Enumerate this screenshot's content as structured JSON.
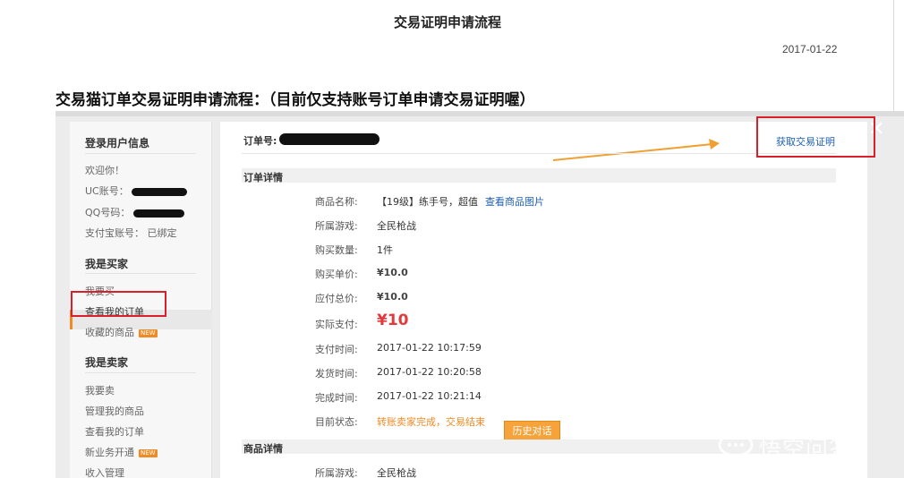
{
  "doc": {
    "title": "交易证明申请流程",
    "date": "2017-01-22",
    "heading": "交易猫订单交易证明申请流程：（目前仅支持账号订单申请交易证明喔）"
  },
  "sidebar": {
    "user_section": {
      "title": "登录用户信息",
      "welcome": "欢迎你！",
      "uc_label": "UC账号：",
      "qq_label": "QQ号码：",
      "alipay": "支付宝账号：  已绑定"
    },
    "buyer_section": {
      "title": "我是买家",
      "items": [
        "我要买",
        "查看我的订单",
        "收藏的商品"
      ]
    },
    "seller_section": {
      "title": "我是卖家",
      "items": [
        "我要卖",
        "管理我的商品",
        "查看我的订单",
        "新业务开通",
        "收入管理"
      ]
    },
    "new_badge": "NEW"
  },
  "order": {
    "number_label": "订单号:",
    "get_cert": "获取交易证明",
    "details_title": "订单详情",
    "goods_title": "商品详情",
    "history_button": "历史对话",
    "view_images": "查看商品图片",
    "fields": [
      {
        "label": "商品名称:",
        "value": "【19级】练手号，超值"
      },
      {
        "label": "所属游戏:",
        "value": "全民枪战"
      },
      {
        "label": "购买数量:",
        "value": "1件"
      },
      {
        "label": "购买单价:",
        "value": "¥10.0"
      },
      {
        "label": "应付总价:",
        "value": "¥10.0"
      },
      {
        "label": "实际支付:",
        "value": "¥10"
      },
      {
        "label": "支付时间:",
        "value": "2017-01-22 10:17:59"
      },
      {
        "label": "发货时间:",
        "value": "2017-01-22 10:20:58"
      },
      {
        "label": "完成时间:",
        "value": "2017-01-22 10:21:14"
      },
      {
        "label": "目前状态:",
        "value": "转账卖家完成，交易结束"
      }
    ],
    "goods_fields": [
      {
        "label": "所属游戏:",
        "value": "全民枪战"
      }
    ]
  },
  "watermark": "悟空问答",
  "colors": {
    "accent": "#f08a24",
    "link": "#1e5fb3",
    "highlight_box": "#d9202a",
    "price": "#e4393c"
  }
}
